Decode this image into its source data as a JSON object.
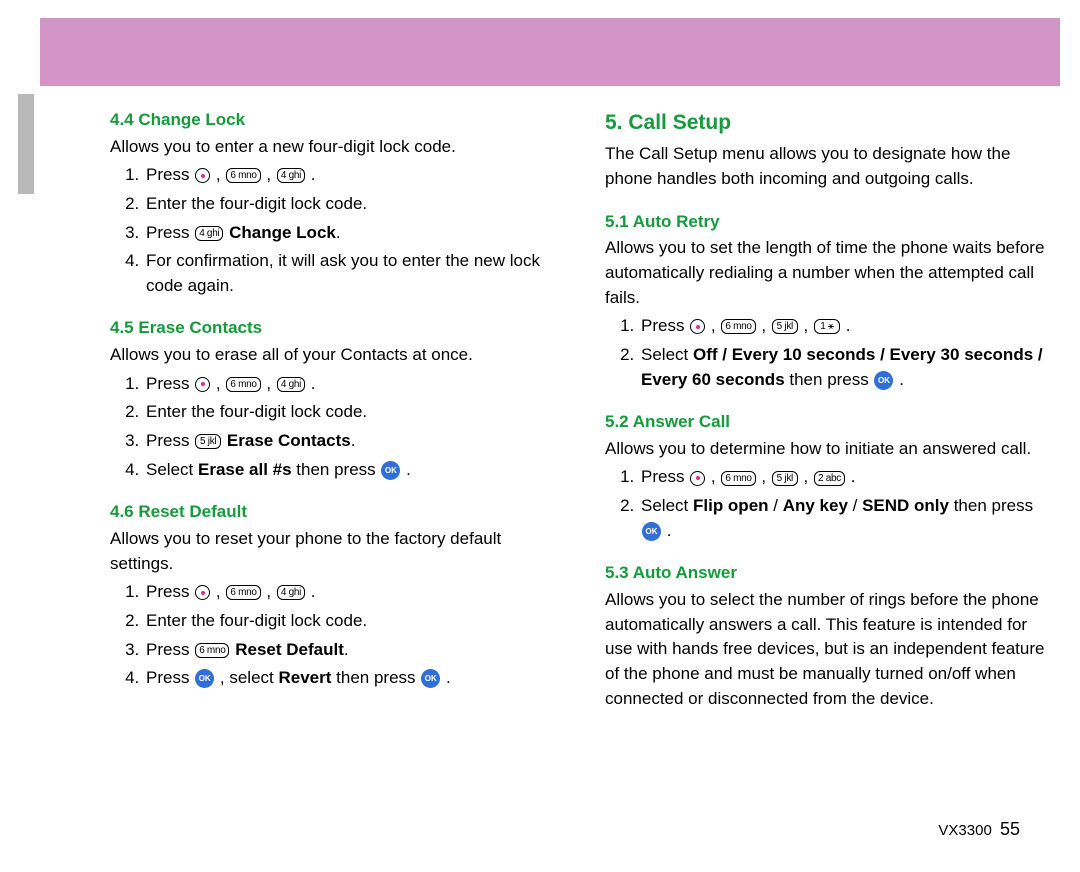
{
  "footer": {
    "model": "VX3300",
    "page": "55"
  },
  "keys": {
    "k1": "1 ⚹",
    "k2": "2 abc",
    "k4": "4 ghi",
    "k5": "5 jkl",
    "k6": "6 mno",
    "ok": "OK"
  },
  "left": {
    "s44": {
      "head": "4.4 Change Lock",
      "intro": "Allows you to enter a new four-digit lock code.",
      "step1a": "Press ",
      "step2": "Enter the four-digit lock code.",
      "step3a": "Press ",
      "step3b": " Change Lock",
      "step4": "For confirmation, it will ask you to enter the new lock code again."
    },
    "s45": {
      "head": "4.5 Erase Contacts",
      "intro": "Allows you to erase all of your Contacts at once.",
      "step1a": "Press ",
      "step2": "Enter the four-digit lock code.",
      "step3a": "Press ",
      "step3b": " Erase Contacts",
      "step4a": "Select ",
      "step4b": "Erase all #s",
      "step4c": " then press "
    },
    "s46": {
      "head": "4.6 Reset Default",
      "intro": "Allows you to reset your phone to the factory default settings.",
      "step1a": "Press ",
      "step2": "Enter the four-digit lock code.",
      "step3a": "Press ",
      "step3b": " Reset Default",
      "step4a": "Press ",
      "step4b": " , select ",
      "step4c": "Revert",
      "step4d": " then press "
    }
  },
  "right": {
    "title": "5. Call Setup",
    "intro": "The Call Setup menu allows you to designate how the phone handles both incoming and outgoing calls.",
    "s51": {
      "head": "5.1 Auto Retry",
      "intro": "Allows you to set the length of time the phone waits before automatically redialing a number when the attempted call fails.",
      "step1a": "Press ",
      "step2a": "Select ",
      "step2b": "Off / Every 10 seconds / Every 30 seconds / Every 60 seconds",
      "step2c": "  then press "
    },
    "s52": {
      "head": "5.2 Answer Call",
      "intro": "Allows you to determine how to initiate an answered call.",
      "step1a": "Press ",
      "step2a": "Select ",
      "step2b": "Flip open",
      "step2c": " / ",
      "step2d": "Any key",
      "step2e": " / ",
      "step2f": "SEND only",
      "step2g": " then press "
    },
    "s53": {
      "head": "5.3 Auto Answer",
      "intro": "Allows you to select the number of rings before the phone automatically answers a call. This feature is intended for use with hands free devices, but is an independent feature of the phone and must be manually turned on/off when connected or disconnected from the device."
    }
  }
}
